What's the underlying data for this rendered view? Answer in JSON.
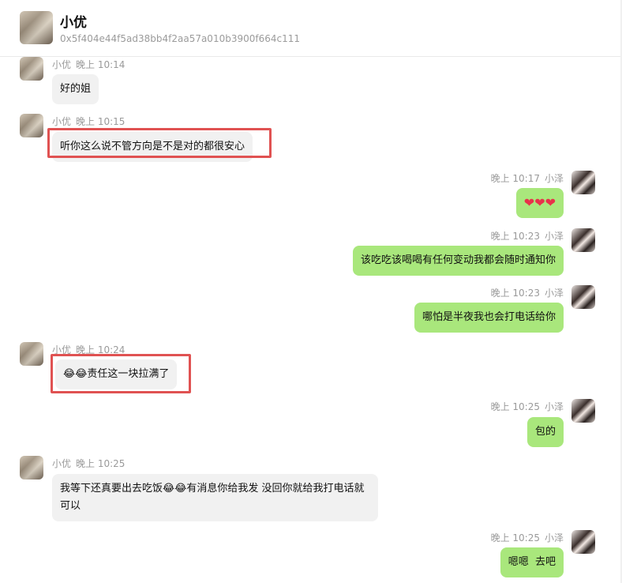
{
  "chat": {
    "contact_name": "小优",
    "contact_address": "0x5f404e44f5ad38bb4f2aa57a010b3900f664c111"
  },
  "messages": [
    {
      "sender": "小优",
      "time": "晚上 10:14",
      "text": "好的姐"
    },
    {
      "sender": "小优",
      "time": "晚上 10:15",
      "text": "听你这么说不管方向是不是对的都很安心"
    },
    {
      "sender": "小泽",
      "time": "晚上 10:17",
      "text": "❤❤❤"
    },
    {
      "sender": "小泽",
      "time": "晚上 10:23",
      "text": "该吃吃该喝喝有任何变动我都会随时通知你"
    },
    {
      "sender": "小泽",
      "time": "晚上 10:23",
      "text": "哪怕是半夜我也会打电话给你"
    },
    {
      "sender": "小优",
      "time": "晚上 10:24",
      "text": "😂😂责任这一块拉满了"
    },
    {
      "sender": "小泽",
      "time": "晚上 10:25",
      "text": "包的"
    },
    {
      "sender": "小优",
      "time": "晚上 10:25",
      "text": "我等下还真要出去吃饭😂😂有消息你给我发 没回你就给我打电话就可以"
    },
    {
      "sender": "小泽",
      "time": "晚上 10:25",
      "text": "嗯嗯  去吧"
    }
  ],
  "colors": {
    "incoming_bubble": "#f1f1f1",
    "outgoing_bubble": "#a9e77c",
    "highlight_border": "#e05252"
  }
}
